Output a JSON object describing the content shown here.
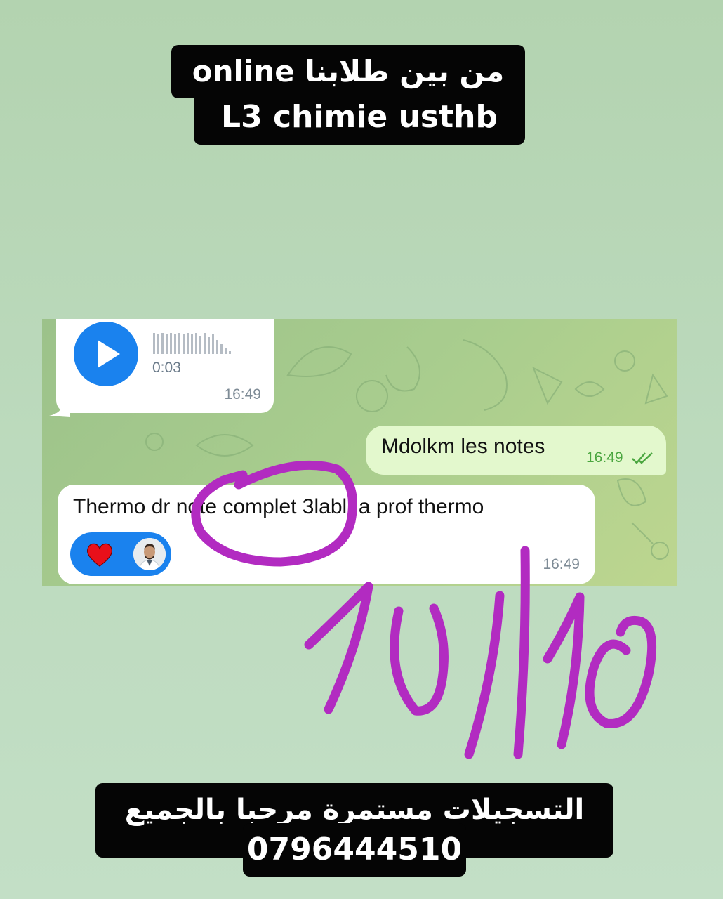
{
  "header_caption": {
    "line1": "من بين طلابنا online",
    "line2": "L3 chimie usthb"
  },
  "chat": {
    "voice_message": {
      "duration": "0:03",
      "time": "16:49",
      "accent_color": "#1a82ee"
    },
    "outgoing_message": {
      "text": "Mdolkm les notes",
      "time": "16:49",
      "status_icon": "double-check-icon"
    },
    "incoming_message": {
      "text": "Thermo dr note complet 3lablha prof thermo",
      "time": "16:49",
      "reaction": "heart-icon"
    }
  },
  "annotation": {
    "score": "10/10",
    "ink_color": "#b22bc1"
  },
  "footer_caption": {
    "line1": "التسجيلات مستمرة مرحبا بالجميع",
    "line2": "0796444510"
  }
}
